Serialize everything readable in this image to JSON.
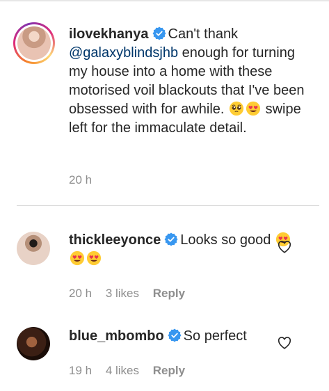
{
  "comments": [
    {
      "username": "ilovekhanya",
      "text_before_mention": "Can't thank",
      "mention": "@galaxyblindsjhb",
      "text_after_mention": "enough for turning my house into a home with these motorised voil blackouts that I've been obsessed with for awhile.",
      "emojis": [
        "pleading-face",
        "heart-eyes-face"
      ],
      "text_end": "swipe left for the immaculate detail.",
      "time": "20 h"
    },
    {
      "username": "thickleeyonce",
      "text": "Looks so good",
      "emojis": [
        "heart-eyes-face",
        "heart-eyes-face",
        "heart-eyes-face"
      ],
      "time": "20 h",
      "likes": "3 likes",
      "reply": "Reply"
    },
    {
      "username": "blue_mbombo",
      "text": "So perfect",
      "time": "19 h",
      "likes": "4 likes",
      "reply": "Reply"
    }
  ],
  "colors": {
    "verified_blue": "#3897f0",
    "mention_blue": "#00376b",
    "meta_gray": "#8e8e8e",
    "text": "#262626"
  }
}
